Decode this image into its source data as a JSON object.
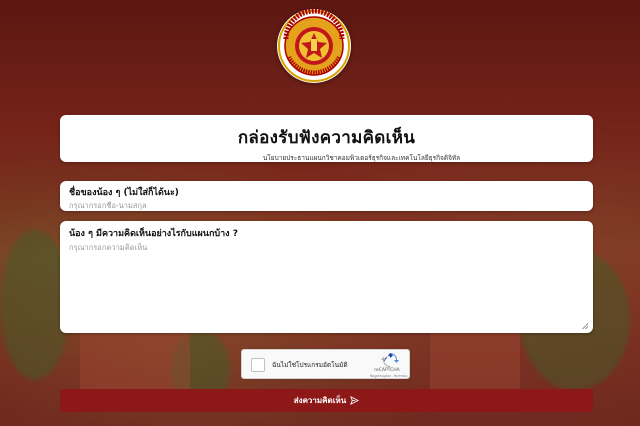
{
  "header": {
    "logo_text": "วิทยาลัยเทคนิคพัทลุง PHATTHALUNG TECHNICAL COLLEGE"
  },
  "form": {
    "title": "กล่องรับฟังความคิดเห็น",
    "subtitle": "นโยบายประธานแผนกวิชาคอมพิวเตอร์ธุรกิจและเทคโนโลยีธุรกิจดิจิทัล",
    "name_label": "ชื่อของน้อง ๆ (ไม่ใส่ก็ได้นะ)",
    "name_placeholder": "กรุณากรอกชื่อ-นามสกุล",
    "comment_label": "น้อง ๆ มีความคิดเห็นอย่างไรกับแผนกบ้าง ?",
    "comment_placeholder": "กรุณากรอกความคิดเห็น",
    "submit_label": "ส่งความคิดเห็น"
  },
  "recaptcha": {
    "label": "ฉันไม่ใช่โปรแกรมอัตโนมัติ",
    "brand": "reCAPTCHA",
    "terms": "ข้อมูลส่วนบุคคล - ข้อกำหนด",
    "checked": false
  },
  "colors": {
    "button_bg": "#8c1818",
    "background": "#6d1f17"
  }
}
